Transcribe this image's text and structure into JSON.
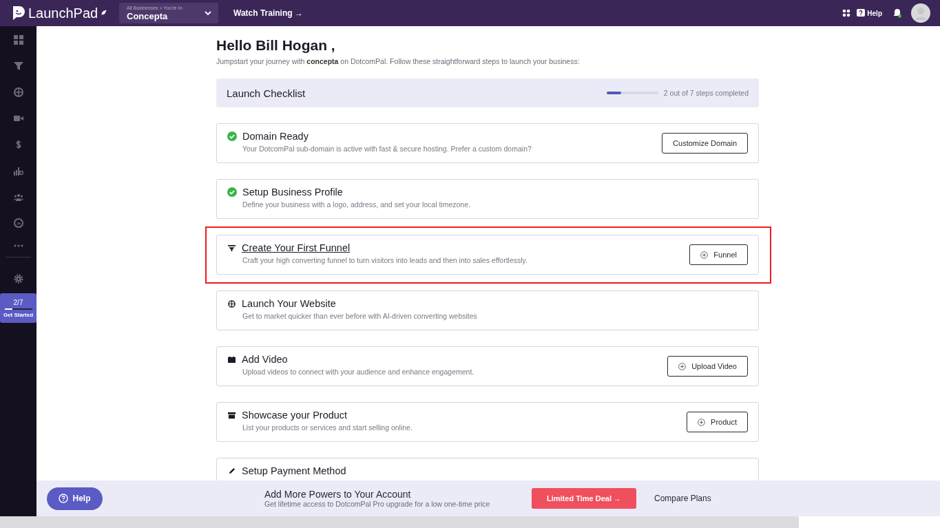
{
  "topbar": {
    "logo": "LaunchPad",
    "business_switcher": {
      "caption": "All Businesses > You're In",
      "value": "Concepta"
    },
    "link": "Watch Training →",
    "help": "Help"
  },
  "sidebar": {
    "progress": {
      "count": "2/7",
      "level": 0.29,
      "label": "Get Started"
    }
  },
  "greeting": {
    "title": "Hello Bill Hogan ,",
    "subtitle": "Jumpstart your journey with **concepta** on DotcomPal. Follow these straightforward steps to launch your business:"
  },
  "checklist": {
    "title": "Launch Checklist",
    "level": 0.28,
    "status": "2 out of 7 steps completed"
  },
  "steps": [
    {
      "title": "Domain Ready",
      "description": "Your DotcomPal sub-domain is active with fast & secure hosting. Prefer a custom domain?",
      "done": true,
      "highlighted": false,
      "hovered": false,
      "button": {
        "label": "Customize Domain",
        "kind": "plain"
      }
    },
    {
      "title": "Setup Business Profile",
      "description": "Define your business with a logo, address, and set your local timezone.",
      "done": true,
      "highlighted": false,
      "hovered": false
    },
    {
      "title": "Create Your First Funnel",
      "description": "Craft your high converting funnel to turn visitors into leads and then into sales effortlessly.",
      "done": false,
      "highlighted": true,
      "hovered": true,
      "button": {
        "label": "Funnel",
        "kind": "add"
      }
    },
    {
      "title": "Launch Your Website",
      "description": "Get to market quicker than ever before with AI-driven converting websites",
      "done": false,
      "highlighted": false,
      "hovered": false
    },
    {
      "title": "Add Video",
      "description": "Upload videos to connect with your audience and enhance engagement.",
      "done": false,
      "highlighted": false,
      "hovered": false,
      "button": {
        "label": "Upload Video",
        "kind": "add"
      }
    },
    {
      "title": "Showcase your Product",
      "description": "List your products or services and start selling online.",
      "done": false,
      "highlighted": false,
      "hovered": false,
      "button": {
        "label": "Product",
        "kind": "add"
      }
    },
    {
      "title": "Setup Payment Method",
      "done": false,
      "highlighted": false,
      "hovered": false
    }
  ],
  "bottom_bar": {
    "help": "Help",
    "title": "Add More Powers to Your Account",
    "subtitle": "Get lifetime access to DotcomPal Pro upgrade for a low one-time price",
    "deal": "Limited Time Deal →",
    "compare": "Compare Plans"
  }
}
